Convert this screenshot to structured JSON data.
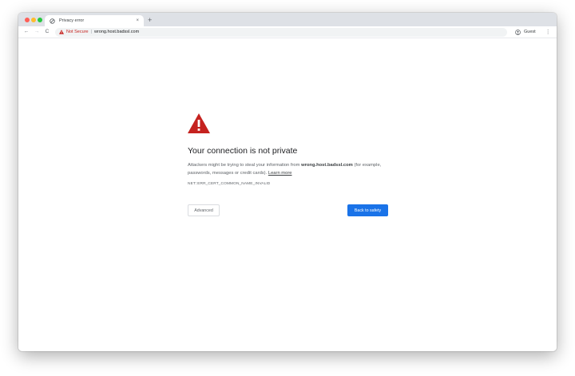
{
  "tab": {
    "title": "Privacy error",
    "favicon": "broken-lock-icon",
    "close_glyph": "×"
  },
  "new_tab_glyph": "+",
  "toolbar": {
    "back_glyph": "←",
    "forward_glyph": "→",
    "reload_glyph": "C",
    "security_label": "Not Secure",
    "separator": "|",
    "url": "wrong.host.badssl.com",
    "profile_label": "Guest",
    "menu_glyph": "⋮"
  },
  "error_page": {
    "icon": "warning-triangle-icon",
    "heading": "Your connection is not private",
    "body_prefix": "Attackers might be trying to steal your information from ",
    "body_host": "wrong.host.badssl.com",
    "body_suffix": " (for example, passwords, messages or credit cards). ",
    "learn_more": "Learn more",
    "error_code": "NET::ERR_CERT_COMMON_NAME_INVALID",
    "advanced_label": "Advanced",
    "back_label": "Back to safety"
  },
  "colors": {
    "accent": "#1a73e8",
    "warning": "#c5221f",
    "tabstrip": "#dee1e6"
  }
}
